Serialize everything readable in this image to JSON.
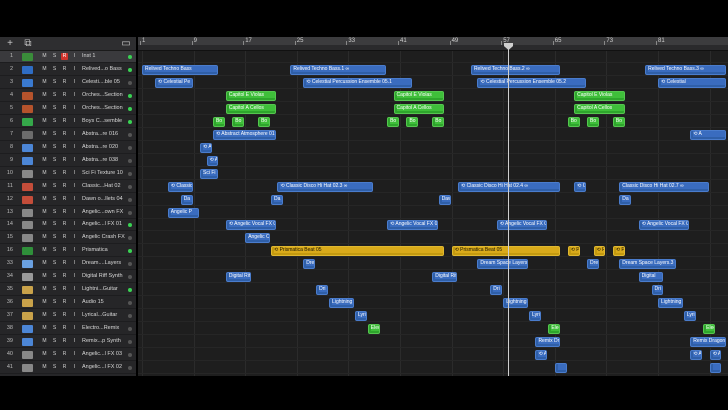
{
  "header": {
    "add_label": "+",
    "copy_label": "⧉",
    "view_label": "▭"
  },
  "ruler": {
    "bars": [
      "1",
      "9",
      "17",
      "25",
      "33",
      "41",
      "49",
      "57",
      "65",
      "73",
      "81"
    ]
  },
  "tracks": [
    {
      "num": "1",
      "name": "Inst 1",
      "color": "#3a8d3a",
      "rec": true,
      "dot": "on"
    },
    {
      "num": "2",
      "name": "Relived...o Bass",
      "color": "#2f6dc4",
      "rec": false,
      "dot": "on"
    },
    {
      "num": "3",
      "name": "Celesti....ble 05",
      "color": "#3a7ad0",
      "rec": false,
      "dot": "off"
    },
    {
      "num": "4",
      "name": "Orches...Section",
      "color": "#b5532c",
      "rec": false,
      "dot": "on"
    },
    {
      "num": "5",
      "name": "Orches...Section",
      "color": "#b5532c",
      "rec": false,
      "dot": "on"
    },
    {
      "num": "6",
      "name": "Boys C...semble",
      "color": "#35a84a",
      "rec": false,
      "dot": "on"
    },
    {
      "num": "7",
      "name": "Abstra...re 016",
      "color": "#6c6c6c",
      "rec": false,
      "dot": "off"
    },
    {
      "num": "8",
      "name": "Abstra...re 020",
      "color": "#4c86d6",
      "rec": false,
      "dot": "off"
    },
    {
      "num": "9",
      "name": "Abstra...re 038",
      "color": "#4c86d6",
      "rec": false,
      "dot": "off"
    },
    {
      "num": "10",
      "name": "Sci Fi Texture 10",
      "color": "#888888",
      "rec": false,
      "dot": "off"
    },
    {
      "num": "11",
      "name": "Classic...Hat 02",
      "color": "#c44d3a",
      "rec": false,
      "dot": "off"
    },
    {
      "num": "12",
      "name": "Dawn o...llets 04",
      "color": "#c44d3a",
      "rec": false,
      "dot": "off"
    },
    {
      "num": "13",
      "name": "Angelic...own FX",
      "color": "#888888",
      "rec": false,
      "dot": "off"
    },
    {
      "num": "14",
      "name": "Angelic...l FX 01",
      "color": "#888888",
      "rec": false,
      "dot": "on"
    },
    {
      "num": "15",
      "name": "Angelic Crash FX",
      "color": "#888888",
      "rec": false,
      "dot": "off"
    },
    {
      "num": "16",
      "name": "Prismatica",
      "color": "#2f8f3a",
      "rec": false,
      "dot": "on"
    },
    {
      "num": "33",
      "name": "Dream....Layers",
      "color": "#6aa0e0",
      "rec": false,
      "dot": "off"
    },
    {
      "num": "34",
      "name": "Digital Riff Synth",
      "color": "#9a9a9a",
      "rec": false,
      "dot": "off"
    },
    {
      "num": "35",
      "name": "Lightni...Guitar",
      "color": "#c9a24a",
      "rec": false,
      "dot": "on"
    },
    {
      "num": "36",
      "name": "Audio 15",
      "color": "#c9a24a",
      "rec": false,
      "dot": "off"
    },
    {
      "num": "37",
      "name": "Lyrical...Guitar",
      "color": "#c9a24a",
      "rec": false,
      "dot": "off"
    },
    {
      "num": "38",
      "name": "Electro...Remix",
      "color": "#4c86d6",
      "rec": false,
      "dot": "off"
    },
    {
      "num": "39",
      "name": "Remix...p Synth",
      "color": "#4c86d6",
      "rec": false,
      "dot": "off"
    },
    {
      "num": "40",
      "name": "Angelic...l FX 03",
      "color": "#888888",
      "rec": false,
      "dot": "off"
    },
    {
      "num": "41",
      "name": "Angelic...l FX 02",
      "color": "#888888",
      "rec": false,
      "dot": "off"
    }
  ],
  "track_controls": {
    "mute": "M",
    "solo": "S",
    "record": "R",
    "input": "I"
  },
  "regions": [
    {
      "lane": 1,
      "bar": 1,
      "len": 12,
      "label": "Relived Techno Bass",
      "color": "blue"
    },
    {
      "lane": 1,
      "bar": 24,
      "len": 15,
      "label": "Relived Techno Bass.1  ∞",
      "color": "blue"
    },
    {
      "lane": 1,
      "bar": 52,
      "len": 14,
      "label": "Relived Techno Bass.2  ∞",
      "color": "blue"
    },
    {
      "lane": 1,
      "bar": 79,
      "len": 14,
      "label": "Relived Techno Bass.3  ∞",
      "color": "blue"
    },
    {
      "lane": 2,
      "bar": 3,
      "len": 6,
      "label": "⟲ Celestial Pe",
      "color": "blue"
    },
    {
      "lane": 2,
      "bar": 26,
      "len": 17,
      "label": "⟲ Celestial Percussion Ensemble 05.1",
      "color": "blue"
    },
    {
      "lane": 2,
      "bar": 53,
      "len": 17,
      "label": "⟲ Celestial Percussion Ensemble 05.2",
      "color": "blue"
    },
    {
      "lane": 2,
      "bar": 81,
      "len": 12,
      "label": "⟲ Celestial",
      "color": "blue"
    },
    {
      "lane": 3,
      "bar": 14,
      "len": 8,
      "label": "Capitol E Violas",
      "color": "green"
    },
    {
      "lane": 3,
      "bar": 40,
      "len": 8,
      "label": "Capitol E Violas",
      "color": "green"
    },
    {
      "lane": 3,
      "bar": 68,
      "len": 8,
      "label": "Capitol E Violas",
      "color": "green"
    },
    {
      "lane": 4,
      "bar": 14,
      "len": 8,
      "label": "Capitol A Cellos",
      "color": "green"
    },
    {
      "lane": 4,
      "bar": 40,
      "len": 8,
      "label": "Capitol A Cellos",
      "color": "green"
    },
    {
      "lane": 4,
      "bar": 68,
      "len": 8,
      "label": "Capitol A Cellos",
      "color": "green"
    },
    {
      "lane": 5,
      "bar": 12,
      "len": 2,
      "label": "Bo",
      "color": "green"
    },
    {
      "lane": 5,
      "bar": 15,
      "len": 2,
      "label": "Bo",
      "color": "green"
    },
    {
      "lane": 5,
      "bar": 19,
      "len": 2,
      "label": "Bo",
      "color": "green"
    },
    {
      "lane": 5,
      "bar": 39,
      "len": 2,
      "label": "Bo",
      "color": "green"
    },
    {
      "lane": 5,
      "bar": 42,
      "len": 2,
      "label": "Bo",
      "color": "green"
    },
    {
      "lane": 5,
      "bar": 46,
      "len": 2,
      "label": "Bo",
      "color": "green"
    },
    {
      "lane": 5,
      "bar": 67,
      "len": 2,
      "label": "Bo",
      "color": "green"
    },
    {
      "lane": 5,
      "bar": 70,
      "len": 2,
      "label": "Bo",
      "color": "green"
    },
    {
      "lane": 5,
      "bar": 74,
      "len": 2,
      "label": "Bo",
      "color": "green"
    },
    {
      "lane": 5,
      "bar": 92,
      "len": 2,
      "label": "Bo",
      "color": "green"
    },
    {
      "lane": 6,
      "bar": 12,
      "len": 10,
      "label": "⟲ Abstract Atmosphere 01",
      "color": "blue"
    },
    {
      "lane": 6,
      "bar": 86,
      "len": 8,
      "label": "⟲ A",
      "color": "blue"
    },
    {
      "lane": 7,
      "bar": 10,
      "len": 2,
      "label": "⟲ A",
      "color": "blue"
    },
    {
      "lane": 8,
      "bar": 11,
      "len": 2,
      "label": "⟲ A",
      "color": "blue"
    },
    {
      "lane": 8,
      "bar": 93,
      "len": 2,
      "label": "⟲",
      "color": "blue"
    },
    {
      "lane": 9,
      "bar": 10,
      "len": 3,
      "label": "Sci Fi Tex",
      "color": "blue"
    },
    {
      "lane": 10,
      "bar": 5,
      "len": 4,
      "label": "⟲ Classic",
      "color": "blue"
    },
    {
      "lane": 10,
      "bar": 22,
      "len": 15,
      "label": "⟲ Classic Disco Hi Hat 02.3  ∞",
      "color": "blue"
    },
    {
      "lane": 10,
      "bar": 50,
      "len": 16,
      "label": "⟲ Classic Disco Hi Hat 02.4  ∞",
      "color": "blue"
    },
    {
      "lane": 10,
      "bar": 68,
      "len": 2,
      "label": "⟲ Cl",
      "color": "blue"
    },
    {
      "lane": 10,
      "bar": 75,
      "len": 14,
      "label": "Classic Disco Hi Hat 02.7  ∞",
      "color": "blue"
    },
    {
      "lane": 11,
      "bar": 7,
      "len": 2,
      "label": "Da",
      "color": "blue"
    },
    {
      "lane": 11,
      "bar": 21,
      "len": 2,
      "label": "Da",
      "color": "blue"
    },
    {
      "lane": 11,
      "bar": 47,
      "len": 2,
      "label": "Daw",
      "color": "blue"
    },
    {
      "lane": 11,
      "bar": 75,
      "len": 2,
      "label": "Da",
      "color": "blue"
    },
    {
      "lane": 12,
      "bar": 5,
      "len": 5,
      "label": "Angelic P",
      "color": "blue"
    },
    {
      "lane": 13,
      "bar": 14,
      "len": 8,
      "label": "⟲ Angelic Vocal FX 0",
      "color": "blue"
    },
    {
      "lane": 13,
      "bar": 39,
      "len": 8,
      "label": "⟲ Angelic Vocal FX 01",
      "color": "blue"
    },
    {
      "lane": 13,
      "bar": 56,
      "len": 8,
      "label": "⟲ Angelic Vocal FX 01",
      "color": "blue"
    },
    {
      "lane": 13,
      "bar": 78,
      "len": 8,
      "label": "⟲ Angelic Vocal FX 01",
      "color": "blue"
    },
    {
      "lane": 14,
      "bar": 17,
      "len": 4,
      "label": "Angelic C",
      "color": "blue"
    },
    {
      "lane": 15,
      "bar": 21,
      "len": 27,
      "label": "⟲ Prismatica Beat 05",
      "color": "yellow"
    },
    {
      "lane": 15,
      "bar": 49,
      "len": 17,
      "label": "⟲ Prismatica Beat 05",
      "color": "yellow"
    },
    {
      "lane": 15,
      "bar": 67,
      "len": 2,
      "label": "⟲ Pr",
      "color": "yellow"
    },
    {
      "lane": 15,
      "bar": 71,
      "len": 2,
      "label": "⟲ Pr",
      "color": "yellow"
    },
    {
      "lane": 15,
      "bar": 74,
      "len": 2,
      "label": "⟲ Pr",
      "color": "yellow"
    },
    {
      "lane": 16,
      "bar": 26,
      "len": 2,
      "label": "Dre",
      "color": "blue"
    },
    {
      "lane": 16,
      "bar": 53,
      "len": 8,
      "label": "Dream Space Layers.1",
      "color": "blue"
    },
    {
      "lane": 16,
      "bar": 70,
      "len": 2,
      "label": "Dre",
      "color": "blue"
    },
    {
      "lane": 16,
      "bar": 75,
      "len": 9,
      "label": "Dream Space Layers.3",
      "color": "blue"
    },
    {
      "lane": 17,
      "bar": 14,
      "len": 4,
      "label": "Digital Riff",
      "color": "blue"
    },
    {
      "lane": 17,
      "bar": 46,
      "len": 4,
      "label": "Digital Riff",
      "color": "blue"
    },
    {
      "lane": 17,
      "bar": 78,
      "len": 4,
      "label": "Digital",
      "color": "blue"
    },
    {
      "lane": 18,
      "bar": 28,
      "len": 2,
      "label": "Dri",
      "color": "blue"
    },
    {
      "lane": 18,
      "bar": 55,
      "len": 2,
      "label": "Dri",
      "color": "blue"
    },
    {
      "lane": 18,
      "bar": 80,
      "len": 2,
      "label": "Dri",
      "color": "blue"
    },
    {
      "lane": 19,
      "bar": 30,
      "len": 4,
      "label": "Lightning",
      "color": "blue"
    },
    {
      "lane": 19,
      "bar": 57,
      "len": 4,
      "label": "Lightning",
      "color": "blue"
    },
    {
      "lane": 19,
      "bar": 81,
      "len": 4,
      "label": "Lightning",
      "color": "blue"
    },
    {
      "lane": 20,
      "bar": 34,
      "len": 2,
      "label": "Lyri",
      "color": "blue"
    },
    {
      "lane": 20,
      "bar": 61,
      "len": 2,
      "label": "Lyri",
      "color": "blue"
    },
    {
      "lane": 20,
      "bar": 85,
      "len": 2,
      "label": "Lyri",
      "color": "blue"
    },
    {
      "lane": 21,
      "bar": 36,
      "len": 2,
      "label": "Elec",
      "color": "green"
    },
    {
      "lane": 21,
      "bar": 64,
      "len": 2,
      "label": "Elec",
      "color": "green"
    },
    {
      "lane": 21,
      "bar": 88,
      "len": 2,
      "label": "Elec",
      "color": "green"
    },
    {
      "lane": 22,
      "bar": 62,
      "len": 4,
      "label": "Remix Dr",
      "color": "blue"
    },
    {
      "lane": 22,
      "bar": 86,
      "len": 8,
      "label": "Remix Dragon Har",
      "color": "blue"
    },
    {
      "lane": 23,
      "bar": 62,
      "len": 2,
      "label": "⟲ A",
      "color": "blue"
    },
    {
      "lane": 23,
      "bar": 86,
      "len": 2,
      "label": "⟲ An",
      "color": "blue"
    },
    {
      "lane": 23,
      "bar": 89,
      "len": 2,
      "label": "⟲ A",
      "color": "blue"
    },
    {
      "lane": 24,
      "bar": 65,
      "len": 2,
      "label": "",
      "color": "blue"
    },
    {
      "lane": 24,
      "bar": 89,
      "len": 2,
      "label": "",
      "color": "blue"
    }
  ]
}
